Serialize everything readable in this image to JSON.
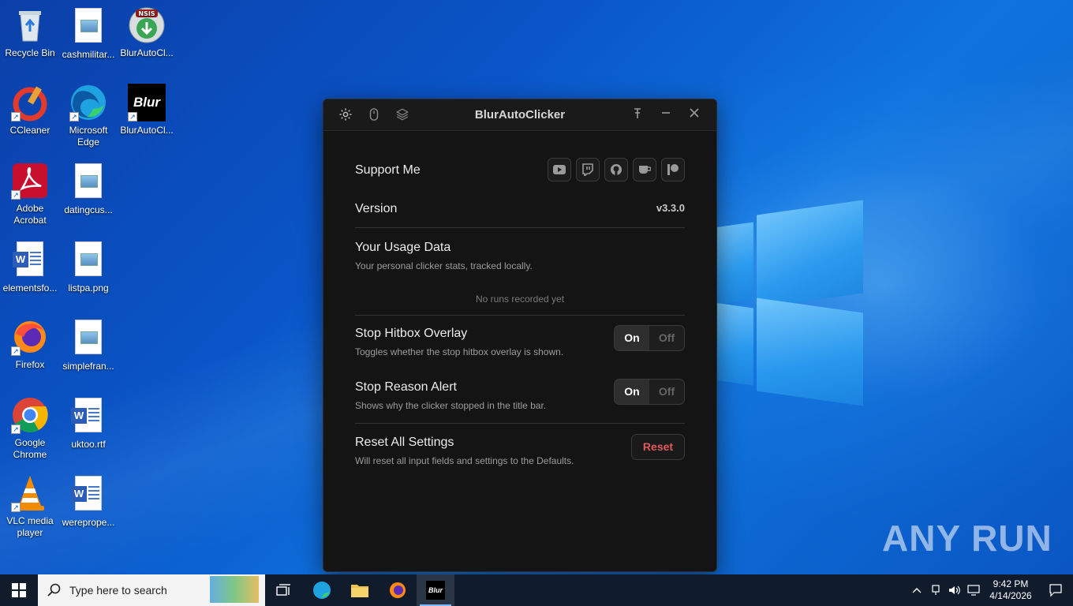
{
  "desktop": {
    "icons": [
      {
        "label": "Recycle Bin"
      },
      {
        "label": "cashmilitar..."
      },
      {
        "label": "BlurAutoCl..."
      },
      {
        "label": "CCleaner"
      },
      {
        "label": "Microsoft Edge"
      },
      {
        "label": "BlurAutoCl..."
      },
      {
        "label": "Adobe Acrobat"
      },
      {
        "label": "datingcus..."
      },
      {
        "label": "elementsfo..."
      },
      {
        "label": "listpa.png"
      },
      {
        "label": "Firefox"
      },
      {
        "label": "simplefran..."
      },
      {
        "label": "Google Chrome"
      },
      {
        "label": "uktoo.rtf"
      },
      {
        "label": "VLC media player"
      },
      {
        "label": "wereprope..."
      }
    ],
    "badge_nsis": "NSIS",
    "badge_blur": "Blur",
    "watermark": "ANY RUN"
  },
  "app": {
    "title": "BlurAutoClicker",
    "accent_red": "#e05a5a",
    "rows": {
      "support": {
        "label": "Support Me"
      },
      "version": {
        "label": "Version",
        "value": "v3.3.0"
      },
      "usage": {
        "label": "Your Usage Data",
        "desc": "Your personal clicker stats, tracked locally.",
        "empty": "No runs recorded yet"
      },
      "hitbox": {
        "label": "Stop Hitbox Overlay",
        "desc": "Toggles whether the stop hitbox overlay is shown.",
        "on": "On",
        "off": "Off"
      },
      "reason": {
        "label": "Stop Reason Alert",
        "desc": "Shows why the clicker stopped in the title bar.",
        "on": "On",
        "off": "Off"
      },
      "reset": {
        "label": "Reset All Settings",
        "desc": "Will reset all input fields and settings to the Defaults.",
        "button": "Reset"
      }
    }
  },
  "taskbar": {
    "search_placeholder": "Type here to search",
    "time": "9:42 PM",
    "date": "4/14/2026",
    "active_app": "Blur"
  }
}
